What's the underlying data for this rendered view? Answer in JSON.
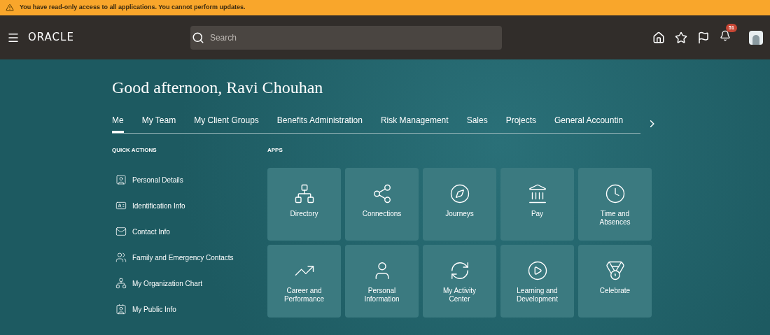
{
  "banner": {
    "text": "You have read-only access to all applications. You cannot perform updates."
  },
  "header": {
    "logo": "ORACLE",
    "search": {
      "placeholder": "Search"
    },
    "notifications": {
      "count": "51"
    }
  },
  "greeting": "Good afternoon, Ravi Chouhan",
  "tabs": [
    {
      "label": "Me",
      "selected": true
    },
    {
      "label": "My Team",
      "selected": false
    },
    {
      "label": "My Client Groups",
      "selected": false
    },
    {
      "label": "Benefits Administration",
      "selected": false
    },
    {
      "label": "Risk Management",
      "selected": false
    },
    {
      "label": "Sales",
      "selected": false
    },
    {
      "label": "Projects",
      "selected": false
    },
    {
      "label": "General Accountin",
      "selected": false
    }
  ],
  "quick_actions": {
    "title": "QUICK ACTIONS",
    "items": [
      "Personal Details",
      "Identification Info",
      "Contact Info",
      "Family and Emergency Contacts",
      "My Organization Chart",
      "My Public Info"
    ]
  },
  "apps": {
    "title": "APPS",
    "items": [
      "Directory",
      "Connections",
      "Journeys",
      "Pay",
      "Time and Absences",
      "Career and Performance",
      "Personal Information",
      "My Activity Center",
      "Learning and Development",
      "Celebrate"
    ]
  }
}
